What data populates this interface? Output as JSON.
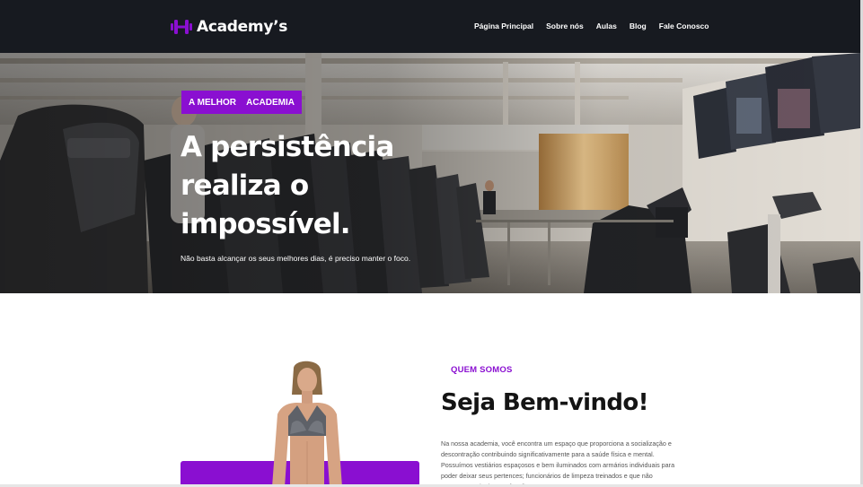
{
  "brand": {
    "name": "Academy’s",
    "accent_color": "#8a0fd1",
    "navbar_color": "#171a20",
    "logo_icon": "dumbbell-icon"
  },
  "nav": {
    "items": [
      {
        "label": "Página Principal"
      },
      {
        "label": "Sobre nós"
      },
      {
        "label": "Aulas"
      },
      {
        "label": "Blog"
      },
      {
        "label": "Fale Conosco"
      }
    ]
  },
  "hero": {
    "badge_left": "A MELHOR",
    "badge_right": "ACADEMIA",
    "title": "A persistência realiza o impossível.",
    "subtitle": "Não basta alcançar os seus melhores dias, é preciso manter o foco.",
    "image": "gym-interior-photo"
  },
  "about": {
    "eyebrow": "QUEM SOMOS",
    "title": "Seja Bem-vindo!",
    "text": "Na nossa academia, você encontra um espaço que proporciona a socialização e descontração contribuindo significativamente para a saúde física e mental. Possuímos vestiários espaçosos e bem iluminados com armários individuais para poder deixar seus pertences; funcionários de limpeza treinados e que não executam mais de uma função.",
    "image": "woman-athlete-photo"
  }
}
